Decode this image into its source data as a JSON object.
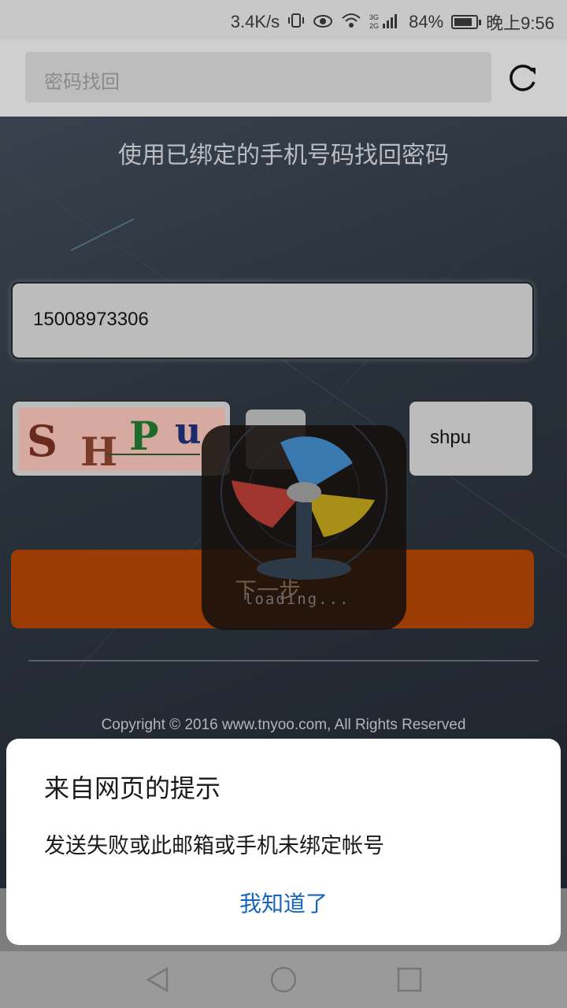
{
  "status_bar": {
    "speed": "3.4K/s",
    "signal": "3G 2G",
    "battery": "84%",
    "battery_level": 0.84,
    "time": "晚上9:56"
  },
  "app_bar": {
    "title": "密码找回"
  },
  "page": {
    "subtitle": "使用已绑定的手机号码找回密码",
    "phone_value": "15008973306",
    "captcha_text": "SHPu",
    "code_value": "shpu",
    "next_label": "下一步",
    "copyright": "Copyright © 2016 www.tnyoo.com, All Rights Reserved"
  },
  "loading": {
    "text": "loading..."
  },
  "dialog": {
    "title": "来自网页的提示",
    "message": "发送失败或此邮箱或手机未绑定帐号",
    "confirm_label": "我知道了"
  },
  "colors": {
    "accent_button": "#9c3c05",
    "dialog_link": "#1565c0"
  }
}
